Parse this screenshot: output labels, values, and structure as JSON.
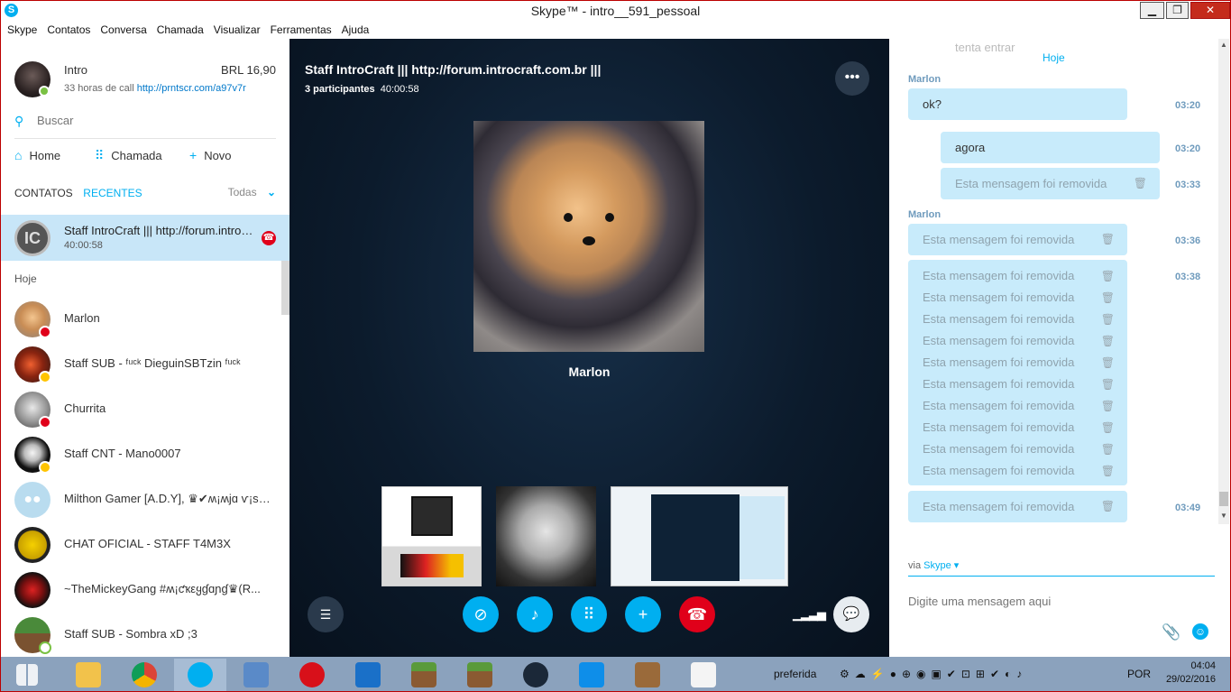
{
  "window": {
    "title": "Skype™ - intro__591_pessoal",
    "minimize": "▁",
    "maximize": "❐",
    "close": "✕"
  },
  "menu": [
    "Skype",
    "Contatos",
    "Conversa",
    "Chamada",
    "Visualizar",
    "Ferramentas",
    "Ajuda"
  ],
  "profile": {
    "name": "Intro",
    "credit": "BRL 16,90",
    "mood_prefix": "33 horas de call ",
    "mood_link": "http://prntscr.com/a97v7r"
  },
  "search": {
    "placeholder": "Buscar"
  },
  "nav": {
    "home": "Home",
    "call": "Chamada",
    "new": "Novo"
  },
  "tabs": {
    "contacts": "CONTATOS",
    "recent": "RECENTES",
    "filter": "Todas"
  },
  "active_call": {
    "name": "Staff IntroCraft ||| http://forum.introcraft.com.br |||",
    "time": "40:00:58"
  },
  "section": "Hoje",
  "contacts": [
    {
      "name": "Marlon"
    },
    {
      "name": "Staff SUB - ᶠᵘᶜᵏ DieguinSBTzin ᶠᵘᶜᵏ"
    },
    {
      "name": "Churrita"
    },
    {
      "name": "Staff CNT - Mano0007"
    },
    {
      "name": "Milthon Gamer [A.D.Y], ♛✔ʍ¡ʍjɑ ѵ¡ѕт..."
    },
    {
      "name": "CHAT OFICIAL - STAFF T4M3X"
    },
    {
      "name": "~TheMickeyGang  #ʍ¡ƈҡεყɠɑɲɠ♛(R..."
    },
    {
      "name": "Staff SUB - Sombra xD ;3"
    }
  ],
  "call": {
    "title": "Staff IntroCraft ||| http://forum.introcraft.com.br |||",
    "participants": "3 participantes",
    "duration": "40:00:58",
    "main_name": "Marlon",
    "more": "•••"
  },
  "chat": {
    "faded": "tenta entrar",
    "day": "Hoje",
    "sender1": "Marlon",
    "msg_ok": "ok?",
    "time_ok": "03:20",
    "msg_agora": "agora",
    "time_agora": "03:20",
    "removed": "Esta mensagem foi removida",
    "time_own_removed": "03:33",
    "sender2": "Marlon",
    "time_r1": "03:36",
    "time_r2": "03:38",
    "time_r3": "03:49",
    "via_prefix": "via ",
    "via_link": "Skype",
    "composer_placeholder": "Digite uma mensagem aqui"
  },
  "taskbar": {
    "lang": "POR",
    "time": "04:04",
    "date": "29/02/2016",
    "pref": "preferida"
  },
  "colors": {
    "accent": "#00aff0",
    "hangup": "#e0001a",
    "bubble": "#c8ebfb",
    "call_bg": "#0c1b2c"
  }
}
